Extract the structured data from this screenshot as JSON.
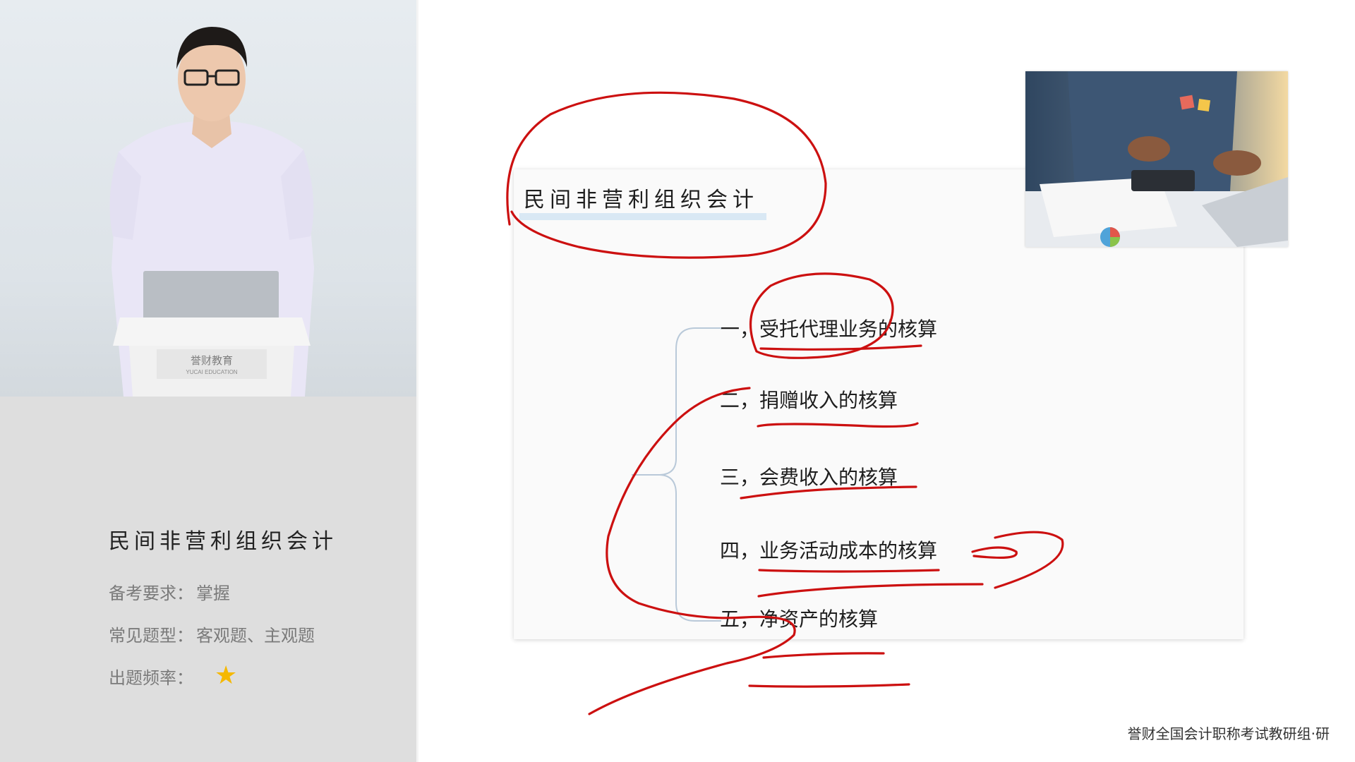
{
  "course_info": {
    "title": "民间非营利组织会计",
    "rows": [
      {
        "label": "备考要求：",
        "value": "掌握"
      },
      {
        "label": "常见题型：",
        "value": "客观题、主观题"
      },
      {
        "label": "出题频率：",
        "value": "★"
      }
    ],
    "frequency_stars": 1
  },
  "video": {
    "podium_label": "誉财教育",
    "podium_sublabel": "YUCAI EDUCATION"
  },
  "slide": {
    "title": "民间非营利组织会计",
    "topics": [
      "一，受托代理业务的核算",
      "二，捐赠收入的核算",
      "三，会费收入的核算",
      "四，业务活动成本的核算",
      "五，净资产的核算"
    ]
  },
  "footer": {
    "credit": "誉财全国会计职称考试教研组·研"
  },
  "colors": {
    "annotation_red": "#cc1010",
    "star": "#f5b800",
    "left_panel": "#dedede"
  }
}
